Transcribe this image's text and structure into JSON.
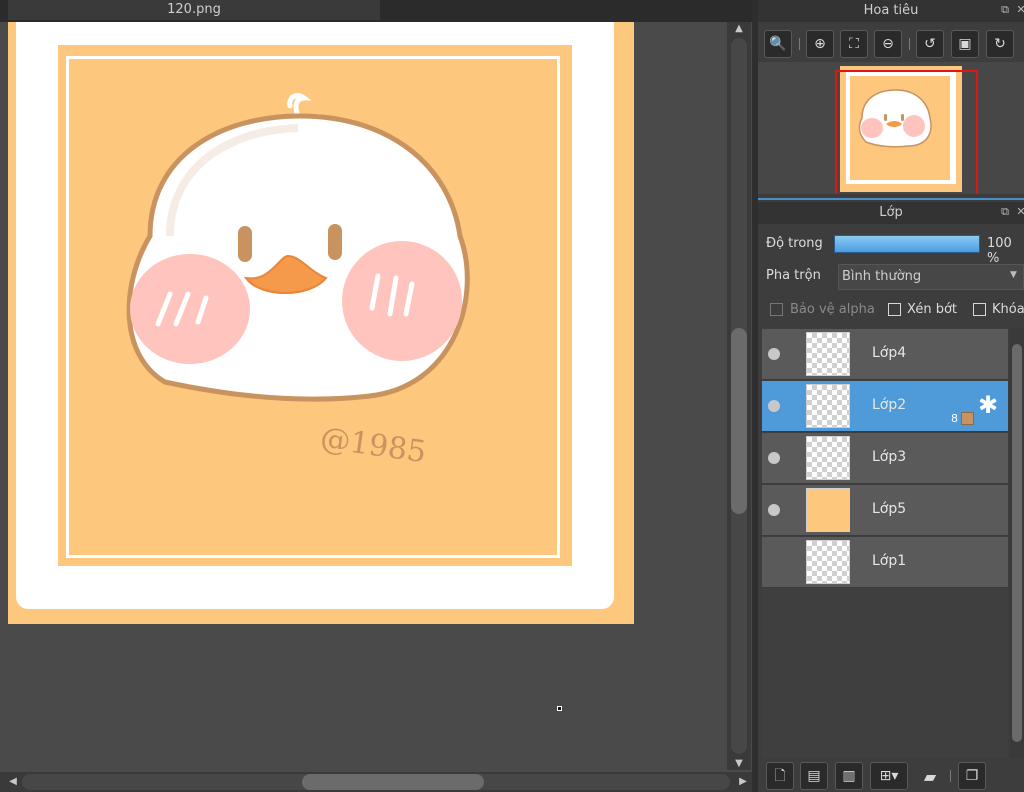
{
  "document": {
    "tab_title": "120.png"
  },
  "artwork": {
    "signature": "@1985"
  },
  "navigator": {
    "title": "Hoa tiêu"
  },
  "layers_panel": {
    "title": "Lớp",
    "opacity_label": "Độ trong",
    "opacity_value": "100 %",
    "blend_label": "Pha trộn",
    "blend_value": "Bình thường",
    "protect_alpha_label": "Bảo vệ alpha",
    "clipping_label": "Xén bớt",
    "lock_label": "Khóa",
    "layers": [
      {
        "name": "Lớp4",
        "visible": true
      },
      {
        "name": "Lớp2",
        "visible": true,
        "selected": true,
        "badge": "8"
      },
      {
        "name": "Lớp3",
        "visible": true
      },
      {
        "name": "Lớp5",
        "visible": true
      },
      {
        "name": "Lớp1",
        "visible": false
      }
    ]
  },
  "colors": {
    "accent": "#4f9ad8",
    "artwork_background": "#fdc77e",
    "navigator_viewport": "#e01515"
  }
}
